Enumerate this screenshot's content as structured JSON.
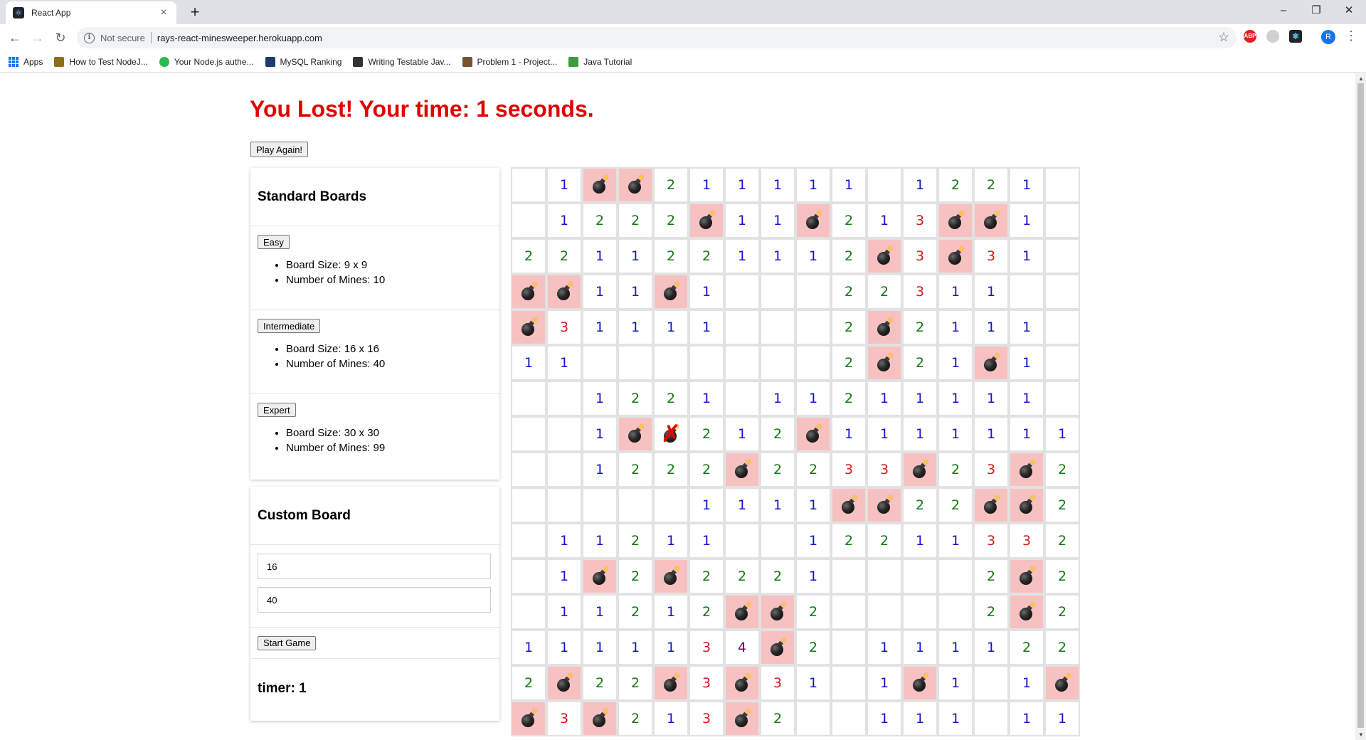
{
  "browser": {
    "tab_title": "React App",
    "url_security": "Not secure",
    "url": "rays-react-minesweeper.herokuapp.com",
    "profile_initial": "R",
    "bookmarks": [
      {
        "label": "Apps",
        "icon": "apps-grid-icon",
        "color": "#1a73e8"
      },
      {
        "label": "How to Test NodeJ...",
        "icon": "node-icon",
        "color": "#8d6e1a"
      },
      {
        "label": "Your Node.js authe...",
        "icon": "clock-icon",
        "color": "#2db84d"
      },
      {
        "label": "MySQL Ranking",
        "icon": "mysql-icon",
        "color": "#1d3b72"
      },
      {
        "label": "Writing Testable Jav...",
        "icon": "book-icon",
        "color": "#333333"
      },
      {
        "label": "Problem 1 - Project...",
        "icon": "project-icon",
        "color": "#7a5230"
      },
      {
        "label": "Java Tutorial",
        "icon": "java-icon",
        "color": "#3c9b3c"
      }
    ]
  },
  "game": {
    "status_title": "You Lost! Your time: 1 seconds.",
    "play_again_label": "Play Again!"
  },
  "standard_boards": {
    "heading": "Standard Boards",
    "options": [
      {
        "button_label": "Easy",
        "size": "Board Size: 9 x 9",
        "mines": "Number of Mines: 10"
      },
      {
        "button_label": "Intermediate",
        "size": "Board Size: 16 x 16",
        "mines": "Number of Mines: 40"
      },
      {
        "button_label": "Expert",
        "size": "Board Size: 30 x 30",
        "mines": "Number of Mines: 99"
      }
    ]
  },
  "custom_board": {
    "heading": "Custom Board",
    "size_value": "16",
    "mines_value": "40",
    "start_label": "Start Game",
    "timer_text": "timer: 1"
  },
  "board": {
    "columns": 16,
    "rows": [
      [
        "",
        "1",
        "*",
        "*",
        "2",
        "1",
        "1",
        "1",
        "1",
        "1",
        "",
        "1",
        "2",
        "2",
        "1",
        ""
      ],
      [
        "",
        "1",
        "2",
        "2",
        "2",
        "*",
        "1",
        "1",
        "*",
        "2",
        "1",
        "3",
        "*",
        "*",
        "1",
        ""
      ],
      [
        "2",
        "2",
        "1",
        "1",
        "2",
        "2",
        "1",
        "1",
        "1",
        "2",
        "*",
        "3",
        "*",
        "3",
        "1",
        ""
      ],
      [
        "*",
        "*",
        "1",
        "1",
        "*",
        "1",
        "",
        "",
        "",
        "2",
        "2",
        "3",
        "1",
        "1",
        "",
        ""
      ],
      [
        "*",
        "3",
        "1",
        "1",
        "1",
        "1",
        "",
        "",
        "",
        "2",
        "*",
        "2",
        "1",
        "1",
        "1",
        ""
      ],
      [
        "1",
        "1",
        "",
        "",
        "",
        "",
        "",
        "",
        "",
        "2",
        "*",
        "2",
        "1",
        "*",
        "1",
        ""
      ],
      [
        "",
        "",
        "1",
        "2",
        "2",
        "1",
        "",
        "1",
        "1",
        "2",
        "1",
        "1",
        "1",
        "1",
        "1",
        ""
      ],
      [
        "",
        "",
        "1",
        "*",
        "X",
        "2",
        "1",
        "2",
        "*",
        "1",
        "1",
        "1",
        "1",
        "1",
        "1",
        "1"
      ],
      [
        "",
        "",
        "1",
        "2",
        "2",
        "2",
        "*",
        "2",
        "2",
        "3",
        "3",
        "*",
        "2",
        "3",
        "*",
        "2"
      ],
      [
        "",
        "",
        "",
        "",
        "",
        "1",
        "1",
        "1",
        "1",
        "*",
        "*",
        "2",
        "2",
        "*",
        "*",
        "2"
      ],
      [
        "",
        "1",
        "1",
        "2",
        "1",
        "1",
        "",
        "",
        "1",
        "2",
        "2",
        "1",
        "1",
        "3",
        "3",
        "2"
      ],
      [
        "",
        "1",
        "*",
        "2",
        "*",
        "2",
        "2",
        "2",
        "1",
        "",
        "",
        "",
        "",
        "2",
        "*",
        "2"
      ],
      [
        "",
        "1",
        "1",
        "2",
        "1",
        "2",
        "*",
        "*",
        "2",
        "",
        "",
        "",
        "",
        "2",
        "*",
        "2"
      ],
      [
        "1",
        "1",
        "1",
        "1",
        "1",
        "3",
        "4",
        "*",
        "2",
        "",
        "1",
        "1",
        "1",
        "1",
        "2",
        "2"
      ],
      [
        "2",
        "*",
        "2",
        "2",
        "*",
        "3",
        "*",
        "3",
        "1",
        "",
        "1",
        "*",
        "1",
        "",
        "1",
        "*"
      ],
      [
        "*",
        "3",
        "*",
        "2",
        "1",
        "3",
        "*",
        "2",
        "",
        "",
        "1",
        "1",
        "1",
        "",
        "1",
        "1"
      ]
    ],
    "legend": {
      "*": "mine",
      "X": "exploded-mine",
      "": "empty"
    },
    "colors": {
      "1": "#1414c8",
      "2": "#107a10",
      "3": "#d11a1a",
      "4": "#6b0a6b",
      "mine_bg": "#f7c1c1"
    }
  }
}
